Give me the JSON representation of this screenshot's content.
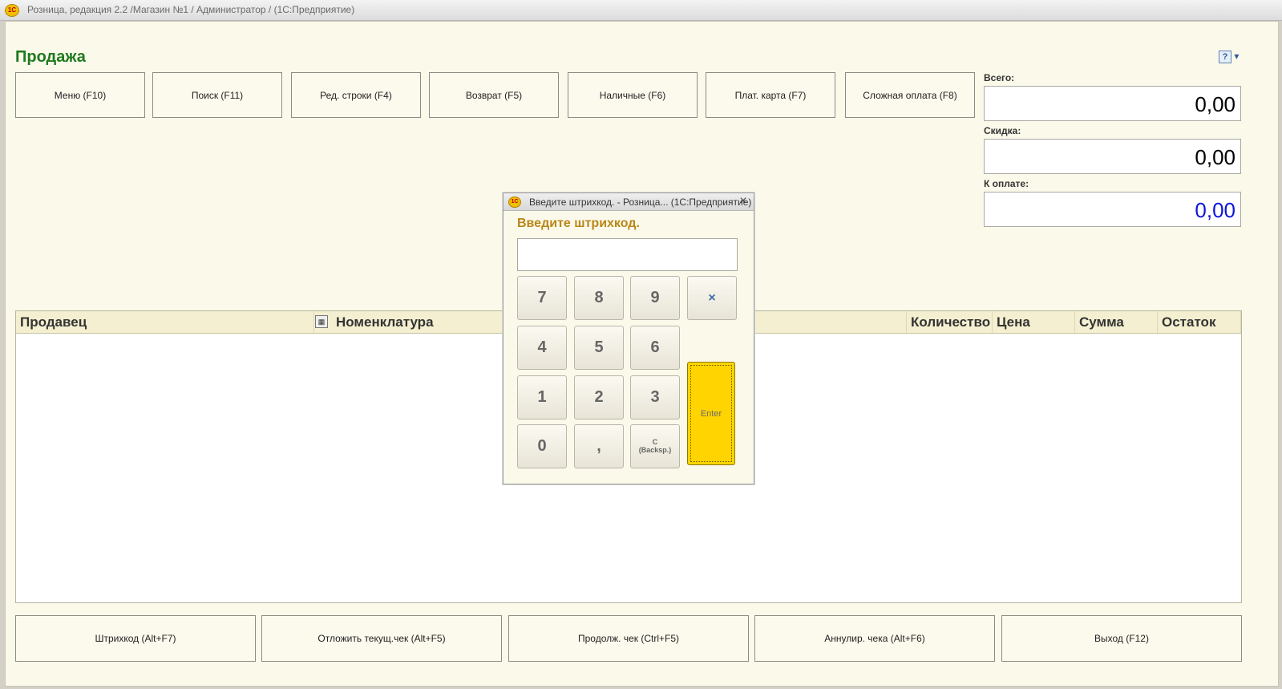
{
  "window": {
    "title": "Розница, редакция 2.2 /Магазин №1 / Администратор /  (1С:Предприятие)",
    "icon": "1c-icon"
  },
  "page": {
    "title": "Продажа",
    "help_icon": "help-icon"
  },
  "toolbar": {
    "buttons": [
      {
        "label": "Меню (F10)"
      },
      {
        "label": "Поиск (F11)"
      },
      {
        "label": "Ред. строки (F4)"
      },
      {
        "label": "Возврат (F5)"
      },
      {
        "label": "Наличные (F6)"
      },
      {
        "label": "Плат. карта (F7)"
      },
      {
        "label": "Сложная оплата (F8)"
      }
    ]
  },
  "summary": {
    "total_label": "Всего:",
    "total_value": "0,00",
    "discount_label": "Скидка:",
    "discount_value": "0,00",
    "pay_label": "К оплате:",
    "pay_value": "0,00",
    "pay_color": "#0e17d8"
  },
  "table": {
    "columns": [
      {
        "label": "Продавец"
      },
      {
        "label": "Номенклатура"
      },
      {
        "label": "Количество"
      },
      {
        "label": "Цена"
      },
      {
        "label": "Сумма"
      },
      {
        "label": "Остаток"
      }
    ]
  },
  "bottom_buttons": [
    {
      "label": "Штрихкод (Alt+F7)"
    },
    {
      "label": "Отложить текущ.чек (Alt+F5)"
    },
    {
      "label": "Продолж. чек (Ctrl+F5)"
    },
    {
      "label": "Аннулир. чека (Alt+F6)"
    },
    {
      "label": "Выход (F12)"
    }
  ],
  "dialog": {
    "title": "Введите штрихкод. - Розница...  (1С:Предприятие)",
    "heading": "Введите штрихкод.",
    "input_value": "",
    "keys": {
      "k7": "7",
      "k8": "8",
      "k9": "9",
      "k4": "4",
      "k5": "5",
      "k6": "6",
      "k1": "1",
      "k2": "2",
      "k3": "3",
      "k0": "0",
      "comma": ",",
      "backspace_line1": "C",
      "backspace_line2": "(Backsp.)",
      "clear": "×",
      "enter": "Enter"
    }
  }
}
